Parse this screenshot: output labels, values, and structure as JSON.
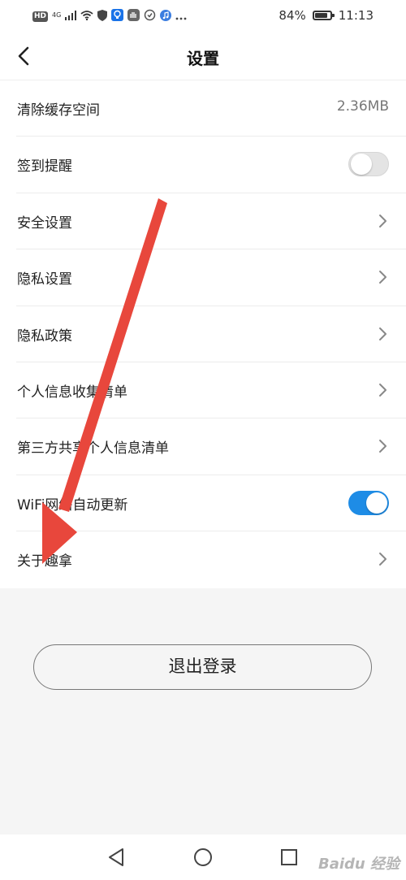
{
  "status_bar": {
    "hd": "HD",
    "network": "4G",
    "battery_percent": "84%",
    "battery_level": 0.84,
    "time": "11:13",
    "icons": [
      "hd-icon",
      "signal-icon",
      "wifi-icon",
      "shield-icon",
      "bulb-icon",
      "hand-icon",
      "sync-icon",
      "music-icon",
      "more-dots-icon"
    ]
  },
  "header": {
    "title": "设置",
    "back_icon": "chevron-left-icon"
  },
  "settings": {
    "items": [
      {
        "label": "清除缓存空间",
        "value": "2.36MB"
      },
      {
        "label": "签到提醒",
        "toggle": "off"
      },
      {
        "label": "安全设置",
        "icon": "chevron-right-icon"
      },
      {
        "label": "隐私设置",
        "icon": "chevron-right-icon"
      },
      {
        "label": "隐私政策",
        "icon": "chevron-right-icon"
      },
      {
        "label": "个人信息收集清单",
        "icon": "chevron-right-icon"
      },
      {
        "label": "第三方共享个人信息清单",
        "icon": "chevron-right-icon"
      },
      {
        "label": "WiFi网络自动更新",
        "toggle": "on"
      },
      {
        "label": "关于趣拿",
        "icon": "chevron-right-icon"
      }
    ]
  },
  "logout_label": "退出登录",
  "nav_bar": {
    "icons": [
      "nav-back-icon",
      "nav-home-icon",
      "nav-recents-icon"
    ]
  },
  "colors": {
    "toggle_on": "#1e8ce6",
    "annotation_arrow": "#e8473c"
  },
  "watermark": "Baidu 经验"
}
